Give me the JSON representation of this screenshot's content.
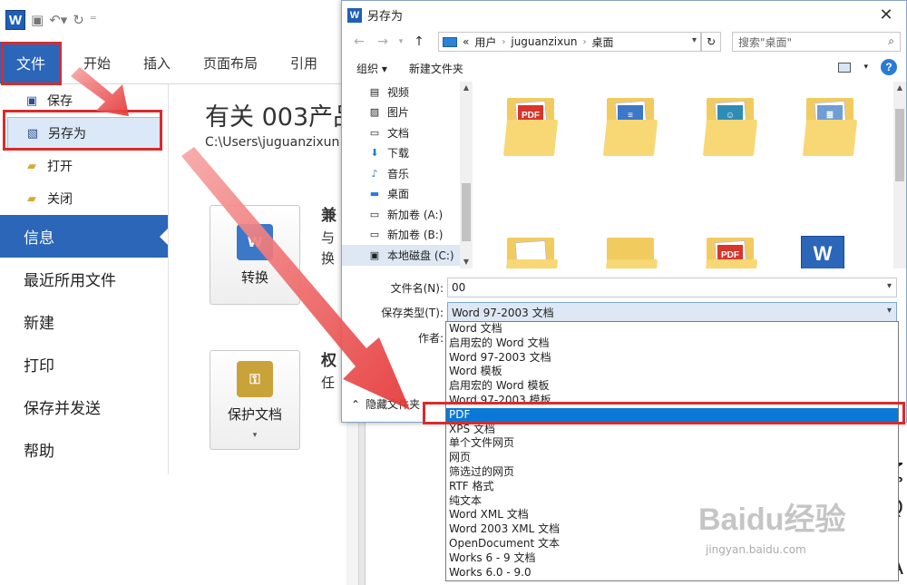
{
  "word": {
    "logo": "W",
    "tabs": {
      "file": "文件",
      "home": "开始",
      "insert": "插入",
      "layout": "页面布局",
      "references": "引用"
    },
    "backstage": {
      "save": "保存",
      "save_as": "另存为",
      "open": "打开",
      "close": "关闭",
      "info": "信息",
      "recent": "最近所用文件",
      "new": "新建",
      "print": "打印",
      "save_send": "保存并发送",
      "help": "帮助"
    },
    "info": {
      "title": "有关 003产品",
      "path": "C:\\Users\\juguanzixun",
      "convert_label": "转换",
      "compat_heading": "兼",
      "compat_line1": "与",
      "compat_line2": "换",
      "protect_label": "保护文档",
      "perm_heading": "权",
      "perm_line1": "任"
    }
  },
  "dialog": {
    "title": "另存为",
    "address": {
      "overflow": "«",
      "crumbs": [
        "用户",
        "juguanzixun",
        "桌面"
      ]
    },
    "search_placeholder": "搜索\"桌面\"",
    "toolbar": {
      "organize": "组织 ▾",
      "new_folder": "新建文件夹"
    },
    "tree": [
      "视频",
      "图片",
      "文档",
      "下载",
      "音乐",
      "桌面",
      "新加卷 (A:)",
      "新加卷 (B:)",
      "本地磁盘 (C:)"
    ],
    "filename_label": "文件名(N):",
    "filename_value": "00",
    "filetype_label": "保存类型(T):",
    "filetype_value": "Word 97-2003 文档",
    "author_label": "作者:",
    "hide_folders": "隐藏文件夹"
  },
  "type_options": [
    "Word 文档",
    "启用宏的 Word 文档",
    "Word 97-2003 文档",
    "Word 模板",
    "启用宏的 Word 模板",
    "Word 97-2003 模板",
    "PDF",
    "XPS 文档",
    "单个文件网页",
    "网页",
    "筛选过的网页",
    "RTF 格式",
    "纯文本",
    "Word XML 文档",
    "Word 2003 XML 文档",
    "OpenDocument 文本",
    "Works 6 - 9 文档",
    "Works 6.0 - 9.0"
  ],
  "watermark": {
    "main": "Baidu经验",
    "sub": "jingyan.baidu.com"
  },
  "doc_glyphs": [
    "ζ",
    "Q",
    "A"
  ],
  "colors": {
    "accent": "#2b66b8",
    "highlight": "#0a78d7",
    "annotation": "#d92b2b"
  }
}
